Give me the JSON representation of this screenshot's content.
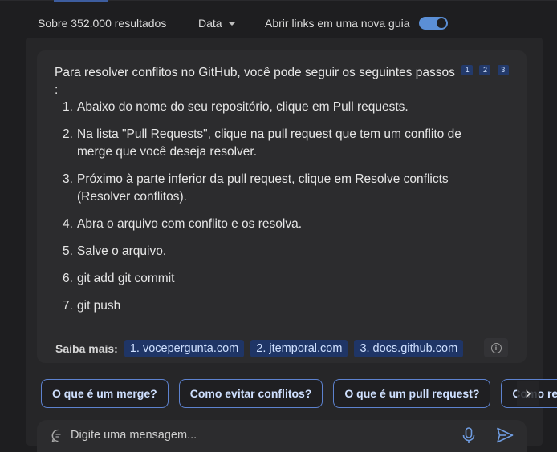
{
  "filters": {
    "results_count": "Sobre 352.000 resultados",
    "date_label": "Data",
    "new_tab_label": "Abrir links em uma nova guia",
    "new_tab_enabled": true
  },
  "answer": {
    "intro": "Para resolver conflitos no GitHub, você pode seguir os seguintes passos",
    "intro_suffix": ":",
    "citations": [
      "1",
      "2",
      "3"
    ],
    "steps": [
      {
        "num": "1.",
        "text": "Abaixo do nome do seu repositório, clique em Pull requests."
      },
      {
        "num": "2.",
        "text": "Na lista \"Pull Requests\", clique na pull request que tem um conflito de merge que você deseja resolver."
      },
      {
        "num": "3.",
        "text": "Próximo à parte inferior da pull request, clique em Resolve conflicts (Resolver conflitos)."
      },
      {
        "num": "4.",
        "text": "Abra o arquivo com conflito e os resolva."
      },
      {
        "num": "5.",
        "text": "Salve o arquivo."
      },
      {
        "num": "6.",
        "text": "git add git commit"
      },
      {
        "num": "7.",
        "text": "git push"
      }
    ],
    "learn_more_label": "Saiba mais:",
    "sources": [
      "1. vocepergunta.com",
      "2. jtemporal.com",
      "3. docs.github.com"
    ]
  },
  "suggestions": [
    "O que é um merge?",
    "Como evitar conflitos?",
    "O que é um pull request?",
    "Como resolver"
  ],
  "composer": {
    "placeholder": "Digite uma mensagem..."
  },
  "colors": {
    "accent": "#5b8fd6",
    "chip_bg": "#1f3566",
    "chip_text": "#cfe0ff"
  }
}
